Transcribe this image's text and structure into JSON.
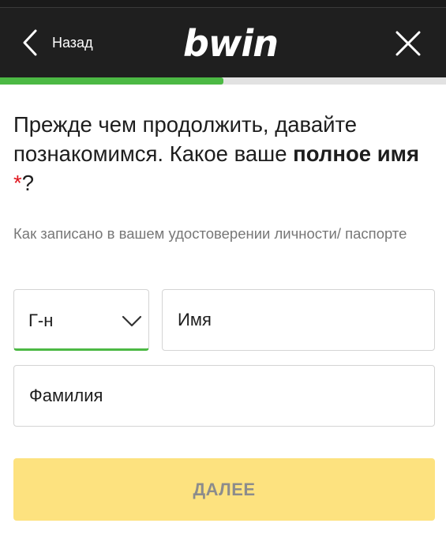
{
  "header": {
    "back_label": "Назад",
    "logo_text": "bwin",
    "back_icon": "chevron-left-icon",
    "close_icon": "close-icon"
  },
  "progress": {
    "fraction": 0.5,
    "fill_color": "#4cb944",
    "track_color": "#e2e2e2"
  },
  "question": {
    "part1": "Прежде чем продолжить, давайте познакомимся. Какое ваше ",
    "bold": "полное имя",
    "required_mark": "*",
    "end": "?"
  },
  "hint": "Как записано в вашем удостоверении личности/ паспорте",
  "form": {
    "title_select": {
      "value": "Г-н",
      "icon": "chevron-down-icon"
    },
    "first_name": {
      "placeholder": "Имя",
      "value": ""
    },
    "last_name": {
      "placeholder": "Фамилия",
      "value": ""
    }
  },
  "next_button": {
    "label": "ДАЛЕЕ",
    "color": "#fde27f"
  },
  "colors": {
    "header_bg": "#1f1f1f",
    "accent_green": "#4cb944",
    "required_red": "#e0161e"
  }
}
